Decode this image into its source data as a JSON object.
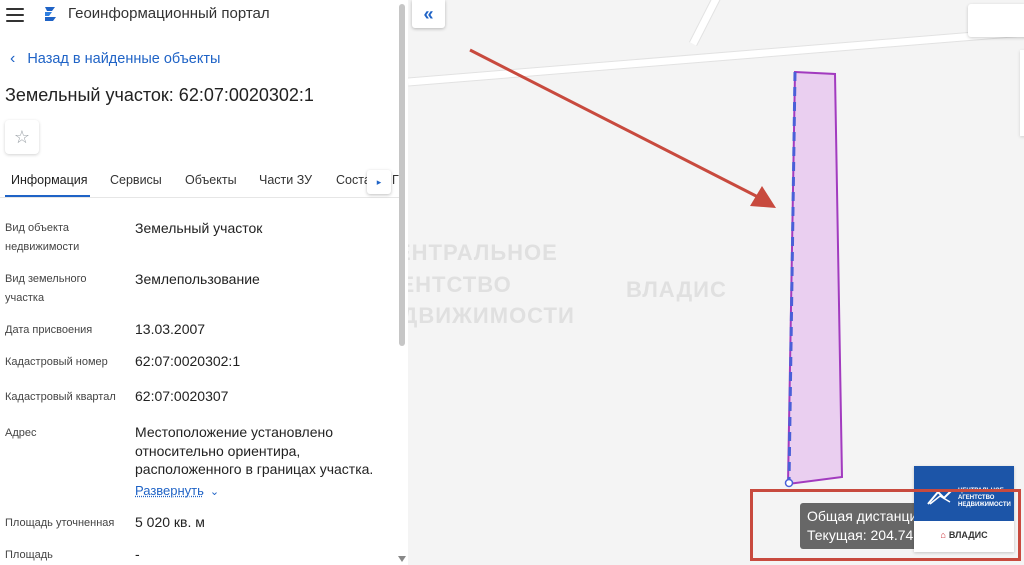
{
  "header": {
    "portal_title": "Геоинформационный портал",
    "hamburger_icon": "menu-icon",
    "logo_icon": "portal-logo-icon"
  },
  "back_link": {
    "label": "Назад в найденные объекты",
    "icon": "chevron-left-icon"
  },
  "parcel": {
    "title": "Земельный участок: 62:07:0020302:1"
  },
  "favorite": {
    "icon": "star-icon",
    "glyph": "☆"
  },
  "tabs": [
    {
      "label": "Информация",
      "active": true
    },
    {
      "label": "Сервисы",
      "active": false
    },
    {
      "label": "Объекты",
      "active": false
    },
    {
      "label": "Части ЗУ",
      "active": false
    },
    {
      "label": "Соста",
      "active": false
    },
    {
      "label": "Г",
      "active": false
    }
  ],
  "tab_next_glyph": "▸",
  "info": [
    {
      "label": "Вид объекта недвижимости",
      "value": "Земельный участок"
    },
    {
      "label": "Вид земельного участка",
      "value": "Землепользование"
    },
    {
      "label": "Дата присвоения",
      "value": "13.03.2007"
    },
    {
      "label": "Кадастровый номер",
      "value": "62:07:0020302:1"
    },
    {
      "label": "Кадастровый квартал",
      "value": "62:07:0020307"
    },
    {
      "label": "Адрес",
      "value": "Местоположение установлено относительно ориентира, расположенного в границах участка.",
      "expand_label": "Развернуть",
      "expand_icon": "chevron-down-icon"
    },
    {
      "label": "Площадь уточненная",
      "value": "5 020 кв. м"
    },
    {
      "label": "Площадь",
      "value": "-"
    }
  ],
  "map": {
    "collapse_glyph": "«",
    "measure_total": "Общая дистанция",
    "measure_current": "Текущая: 204.74",
    "watermark_lines": [
      "ЕНТРАЛЬНОЕ",
      "ГЕНТСТВО",
      "ЕДВИЖИМОСТИ",
      "ВЛАДИС"
    ],
    "parcel_fill": "#e8c8ee",
    "parcel_stroke": "#a23bbf",
    "arrow_color": "#c84a3e"
  },
  "brand": {
    "line1": "ЦЕНТРАЛЬНОЕ",
    "line2": "АГЕНТСТВО",
    "line3": "НЕДВИЖИМОСТИ",
    "name": "ВЛАДИС",
    "house_glyph": "⌂"
  }
}
